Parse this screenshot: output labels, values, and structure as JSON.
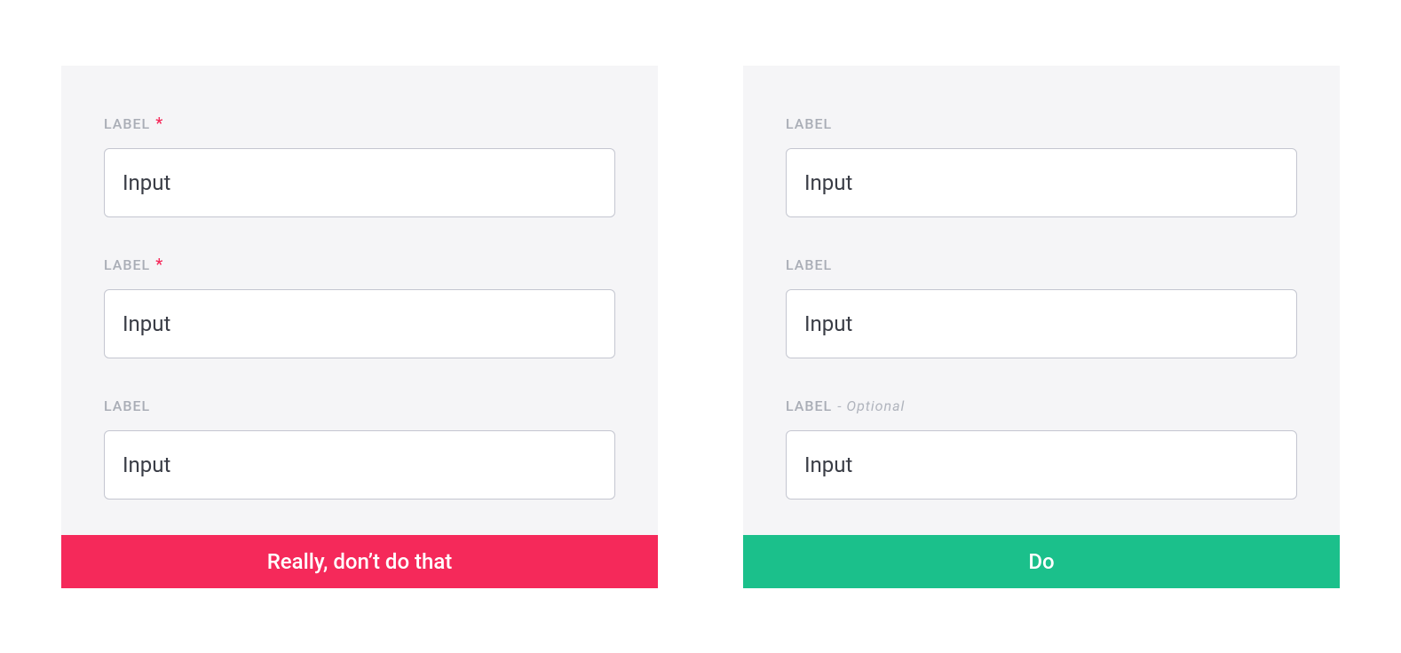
{
  "leftPanel": {
    "fields": [
      {
        "label": "LABEL",
        "required": true,
        "value": "Input"
      },
      {
        "label": "LABEL",
        "required": true,
        "value": "Input"
      },
      {
        "label": "LABEL",
        "required": false,
        "value": "Input"
      }
    ],
    "asterisk": "*",
    "footer": "Really, don’t do that"
  },
  "rightPanel": {
    "fields": [
      {
        "label": "LABEL",
        "value": "Input"
      },
      {
        "label": "LABEL",
        "value": "Input"
      },
      {
        "label": "LABEL",
        "optionalSuffix": "- Optional",
        "value": "Input"
      }
    ],
    "footer": "Do"
  },
  "colors": {
    "dont": "#f5295a",
    "do": "#1bc08b"
  }
}
